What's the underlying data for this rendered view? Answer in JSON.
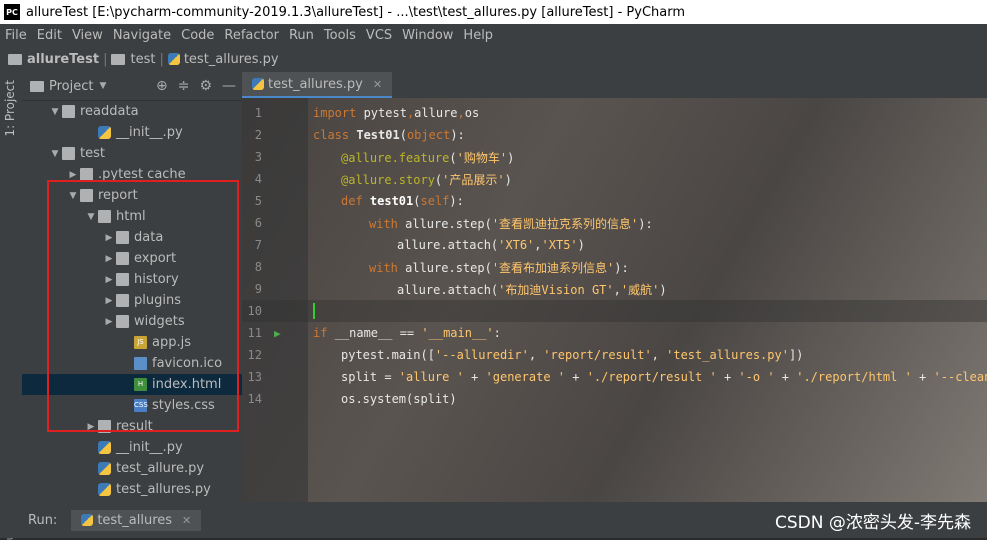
{
  "window": {
    "title": "allureTest [E:\\pycharm-community-2019.1.3\\allureTest] - ...\\test\\test_allures.py [allureTest] - PyCharm",
    "app_badge": "PC"
  },
  "menu": [
    "File",
    "Edit",
    "View",
    "Navigate",
    "Code",
    "Refactor",
    "Run",
    "Tools",
    "VCS",
    "Window",
    "Help"
  ],
  "breadcrumb": [
    "allureTest",
    "test",
    "test_allures.py"
  ],
  "side_tab": "1: Project",
  "side_tab_bottom": "ucture",
  "project": {
    "title": "Project",
    "tree": [
      {
        "label": "readdata",
        "indent": 1,
        "arrow": "▼",
        "type": "folder"
      },
      {
        "label": "__init__.py",
        "indent": 3,
        "arrow": "",
        "type": "py"
      },
      {
        "label": "test",
        "indent": 1,
        "arrow": "▼",
        "type": "folder"
      },
      {
        "label": ".pytest cache",
        "indent": 2,
        "arrow": "▶",
        "type": "folder"
      },
      {
        "label": "report",
        "indent": 2,
        "arrow": "▼",
        "type": "folder"
      },
      {
        "label": "html",
        "indent": 3,
        "arrow": "▼",
        "type": "folder"
      },
      {
        "label": "data",
        "indent": 4,
        "arrow": "▶",
        "type": "folder"
      },
      {
        "label": "export",
        "indent": 4,
        "arrow": "▶",
        "type": "folder"
      },
      {
        "label": "history",
        "indent": 4,
        "arrow": "▶",
        "type": "folder"
      },
      {
        "label": "plugins",
        "indent": 4,
        "arrow": "▶",
        "type": "folder"
      },
      {
        "label": "widgets",
        "indent": 4,
        "arrow": "▶",
        "type": "folder"
      },
      {
        "label": "app.js",
        "indent": 5,
        "arrow": "",
        "type": "js"
      },
      {
        "label": "favicon.ico",
        "indent": 5,
        "arrow": "",
        "type": "ico"
      },
      {
        "label": "index.html",
        "indent": 5,
        "arrow": "",
        "type": "html",
        "selected": true
      },
      {
        "label": "styles.css",
        "indent": 5,
        "arrow": "",
        "type": "css"
      },
      {
        "label": "result",
        "indent": 3,
        "arrow": "▶",
        "type": "folder"
      },
      {
        "label": "__init__.py",
        "indent": 3,
        "arrow": "",
        "type": "py"
      },
      {
        "label": "test_allure.py",
        "indent": 3,
        "arrow": "",
        "type": "py"
      },
      {
        "label": "test_allures.py",
        "indent": 3,
        "arrow": "",
        "type": "py"
      }
    ]
  },
  "editor": {
    "tab_label": "test_allures.py",
    "lines": [
      {
        "n": "1",
        "html": "<span class='kw'>import </span><span class='txt'>pytest</span><span class='kw'>,</span><span class='txt'>allure</span><span class='kw'>,</span><span class='txt'>os</span>",
        "indent": 0
      },
      {
        "n": "2",
        "html": "<span class='kw'>class </span><span class='txt' style='font-weight:bold'>Test01</span><span class='txt'>(</span><span class='kw'>object</span><span class='txt'>):</span>",
        "indent": 0
      },
      {
        "n": "3",
        "html": "<span class='dec'>@allure.feature</span><span class='txt'>(</span><span class='str'>'购物车'</span><span class='txt'>)</span>",
        "indent": 1
      },
      {
        "n": "4",
        "html": "<span class='dec'>@allure.story</span><span class='txt'>(</span><span class='str'>'产品展示'</span><span class='txt'>)</span>",
        "indent": 1
      },
      {
        "n": "5",
        "html": "<span class='kw'>def </span><span class='fn' style='font-weight:bold;color:#fff'>test01</span><span class='txt'>(</span><span class='kw'>self</span><span class='txt'>):</span>",
        "indent": 1
      },
      {
        "n": "6",
        "html": "<span class='kw'>with </span><span class='txt'>allure.step(</span><span class='str'>'查看凯迪拉克系列的信息'</span><span class='txt'>):</span>",
        "indent": 2
      },
      {
        "n": "7",
        "html": "<span class='txt'>allure.attach(</span><span class='str'>'XT6'</span><span class='txt'>,</span><span class='str'>'XT5'</span><span class='txt'>)</span>",
        "indent": 3
      },
      {
        "n": "8",
        "html": "<span class='kw'>with </span><span class='txt'>allure.step(</span><span class='str'>'查看布加迪系列信息'</span><span class='txt'>):</span>",
        "indent": 2
      },
      {
        "n": "9",
        "html": "<span class='txt'>allure.attach(</span><span class='str'>'布加迪Vision GT'</span><span class='txt'>,</span><span class='str'>'威航'</span><span class='txt'>)</span>",
        "indent": 3
      },
      {
        "n": "10",
        "html": "<span style='display:inline-block;width:2px;height:16px;background:#2fd12f;vertical-align:middle'></span>",
        "indent": 0,
        "current": true
      },
      {
        "n": "11",
        "html": "<span class='kw'>if </span><span class='txt'>__name__ == </span><span class='str'>'__main__'</span><span class='txt'>:</span>",
        "indent": 0,
        "run": true
      },
      {
        "n": "12",
        "html": "<span class='txt'>pytest.main([</span><span class='str'>'--alluredir'</span><span class='txt'>, </span><span class='str'>'report/result'</span><span class='txt'>, </span><span class='str'>'test_allures.py'</span><span class='txt'>])</span>",
        "indent": 1
      },
      {
        "n": "13",
        "html": "<span class='txt'>split = </span><span class='str'>'allure '</span><span class='txt'> + </span><span class='str'>'generate '</span><span class='txt'> + </span><span class='str'>'./report/result '</span><span class='txt'> + </span><span class='str'>'-o '</span><span class='txt'> + </span><span class='str'>'./report/html '</span><span class='txt'> + </span><span class='str'>'--clean'</span>",
        "indent": 1
      },
      {
        "n": "14",
        "html": "<span class='txt'>os.system(split)</span>",
        "indent": 1
      }
    ]
  },
  "run_bar": {
    "label": "Run:",
    "tab": "test_allures"
  },
  "watermark": "CSDN @浓密头发-李先森"
}
